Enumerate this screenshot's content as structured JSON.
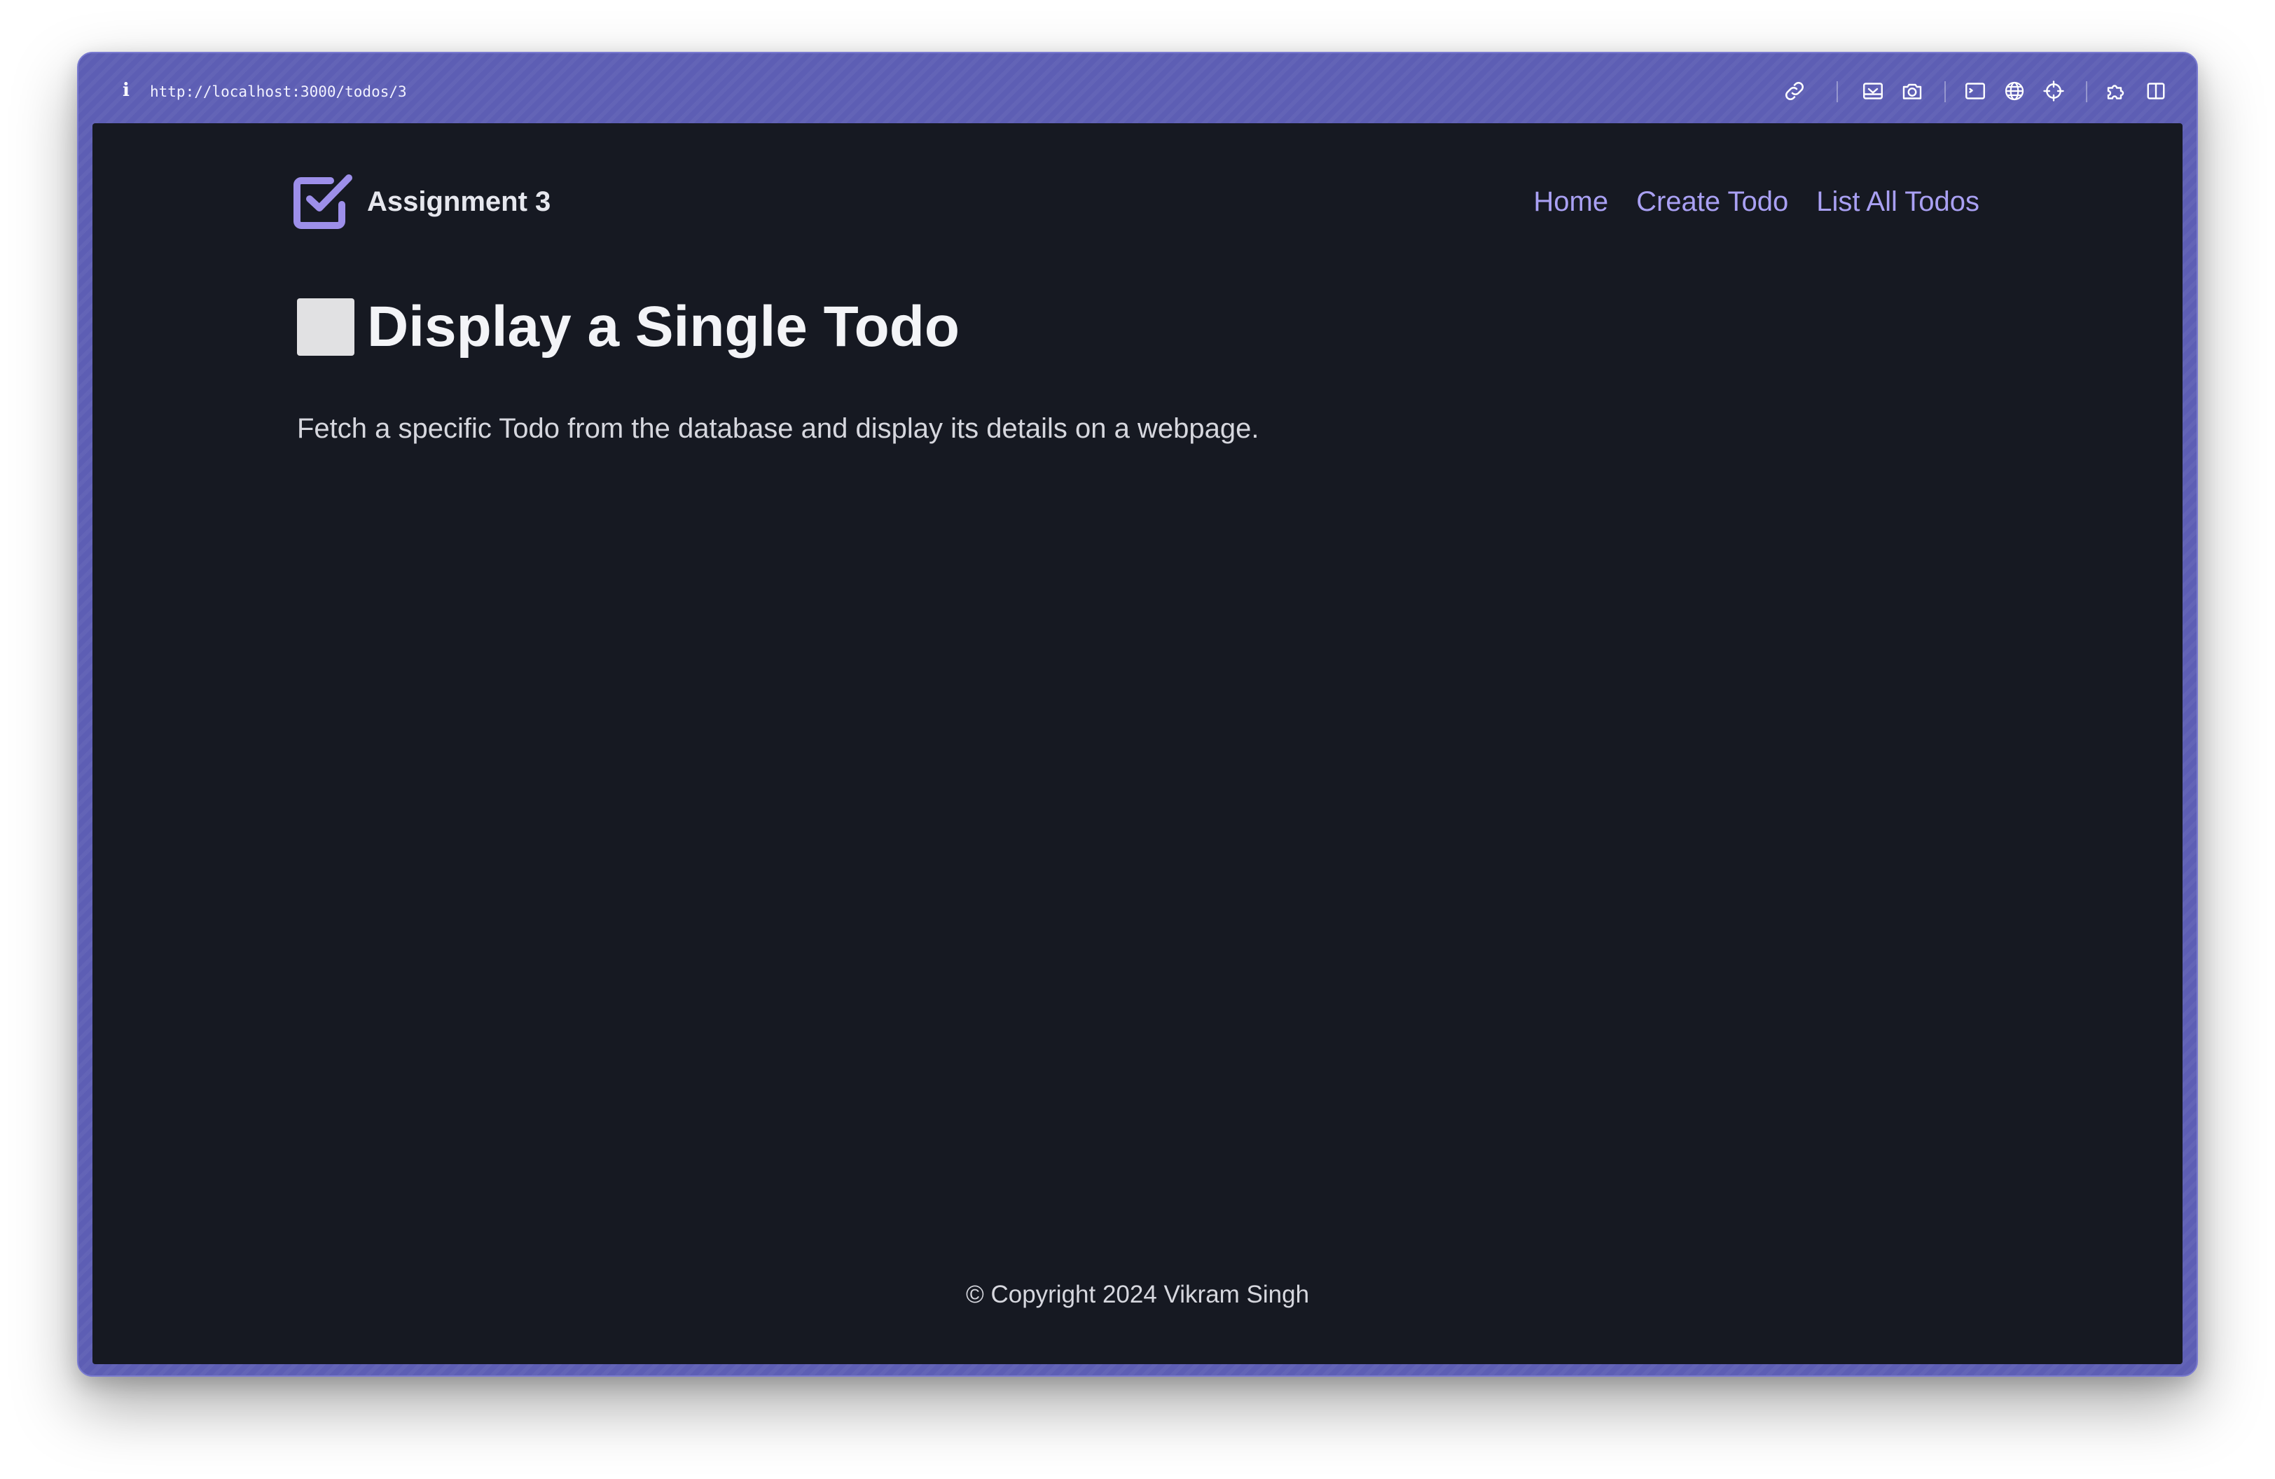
{
  "browser": {
    "url": "http://localhost:3000/todos/3",
    "icons": [
      "info-icon",
      "link-icon",
      "save-page-icon",
      "camera-icon",
      "terminal-icon",
      "globe-icon",
      "crosshair-icon",
      "extension-icon",
      "split-view-icon"
    ]
  },
  "site": {
    "brand": "Assignment 3",
    "nav": [
      "Home",
      "Create Todo",
      "List All Todos"
    ]
  },
  "main": {
    "heading": "Display a Single Todo",
    "description": "Fetch a specific Todo from the database and display its details on a webpage."
  },
  "footer": {
    "text": "© Copyright 2024 Vikram Singh"
  },
  "colors": {
    "frame": "#5d5eb4",
    "background": "#161922",
    "accent": "#a9a0f3",
    "logo": "#9d8fea"
  }
}
